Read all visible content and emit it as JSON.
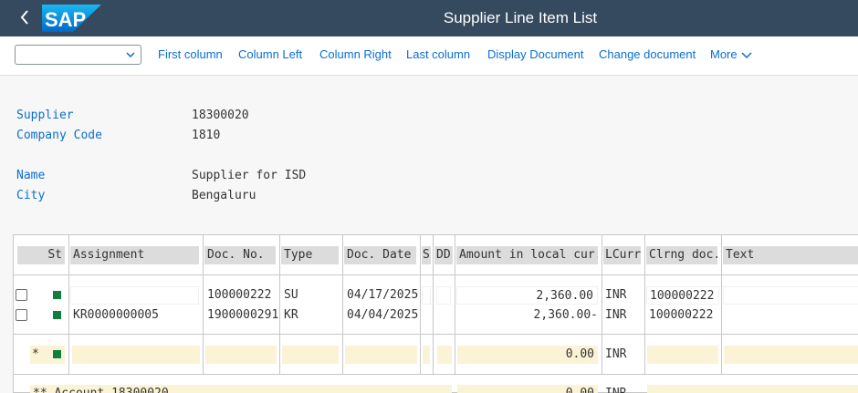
{
  "shell": {
    "title": "Supplier Line Item List",
    "logo_text": "SAP",
    "back_icon": "chevron-left-icon"
  },
  "toolbar": {
    "select_value": "",
    "buttons": [
      "First column",
      "Column Left",
      "Column Right",
      "Last column",
      "Display Document",
      "Change document",
      "More"
    ]
  },
  "header": {
    "supplier_label": "Supplier",
    "supplier_value": "18300020",
    "company_label": "Company Code",
    "company_value": "1810",
    "name_label": "Name",
    "name_value": "Supplier for ISD",
    "city_label": "City",
    "city_value": "Bengaluru"
  },
  "table": {
    "columns": [
      "St",
      "Assignment",
      "Doc. No.",
      "Type",
      "Doc. Date",
      "S",
      "DD",
      "Amount in local cur.",
      "LCurr",
      "Clrng doc.",
      "Text"
    ],
    "rows": [
      {
        "assignment": "",
        "doc_no": "100000222",
        "type": "SU",
        "doc_date": "04/17/2025",
        "s": "",
        "dd": "",
        "amount": "2,360.00",
        "lcurr": "INR",
        "clrng": "100000222",
        "text": ""
      },
      {
        "assignment": "KR0000000005",
        "doc_no": "1900000291",
        "type": "KR",
        "doc_date": "04/04/2025",
        "s": "",
        "dd": "",
        "amount": "2,360.00-",
        "lcurr": "INR",
        "clrng": "100000222",
        "text": ""
      }
    ],
    "total_row": {
      "marker": "*",
      "amount": "0.00",
      "lcurr": "INR"
    },
    "subtotal_row": {
      "label": "** Account 18300020",
      "amount": "0.00",
      "lcurr": "INR"
    }
  },
  "colors": {
    "shell_bg": "#354a5f",
    "link": "#0a6ed1",
    "status_green": "#107e3e",
    "total_bg": "#fbf3d5"
  }
}
